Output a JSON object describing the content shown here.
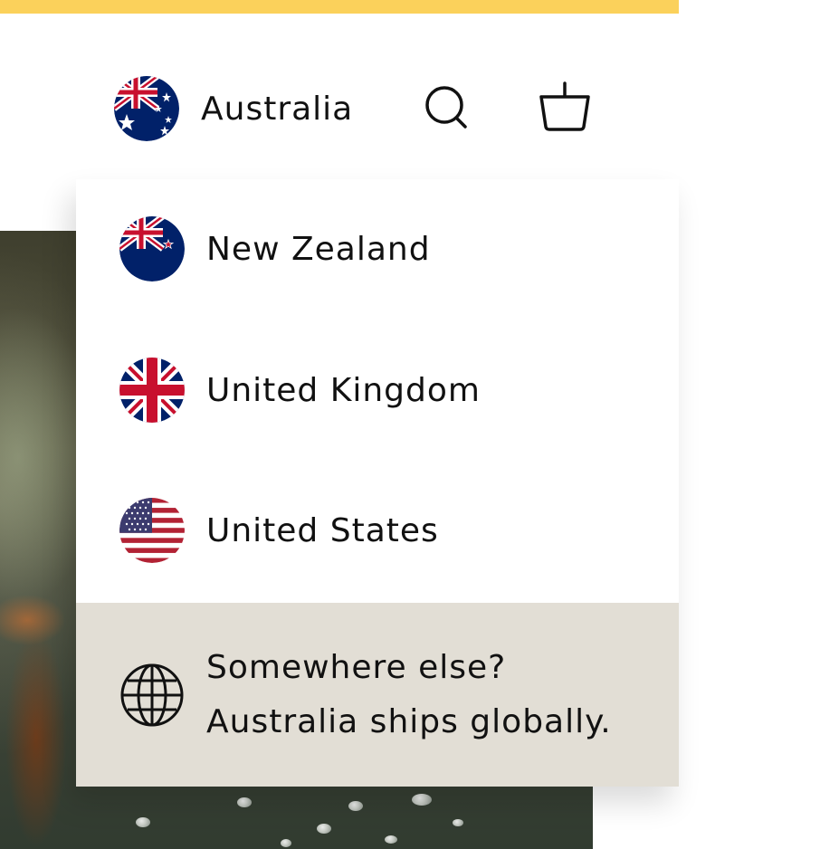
{
  "colors": {
    "accent_bar": "#fbd15b",
    "dropdown_footer_bg": "#e2ded5",
    "text": "#111111"
  },
  "header": {
    "selected_country": {
      "label": "Australia",
      "flag_icon": "australia-flag-icon"
    },
    "search_icon": "search-icon",
    "cart_icon": "basket-icon"
  },
  "dropdown": {
    "options": [
      {
        "label": "New Zealand",
        "flag_icon": "new-zealand-flag-icon"
      },
      {
        "label": "United Kingdom",
        "flag_icon": "united-kingdom-flag-icon"
      },
      {
        "label": "United States",
        "flag_icon": "united-states-flag-icon"
      }
    ],
    "footer": {
      "icon": "globe-icon",
      "line1": "Somewhere else?",
      "line2": "Australia ships globally."
    }
  }
}
